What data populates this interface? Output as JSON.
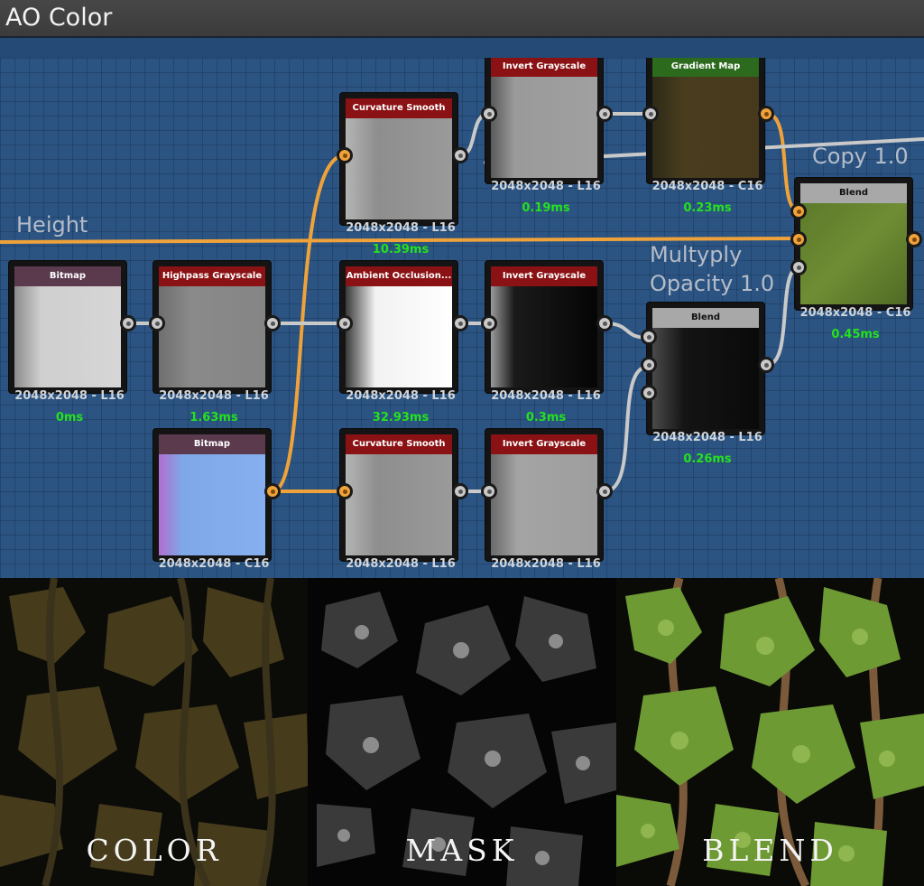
{
  "window": {
    "title": "AO Color"
  },
  "graph": {
    "labels": {
      "height": "Height",
      "copy": "Copy 1.0",
      "multiply": "Multyply",
      "opacity": "Opacity 1.0"
    },
    "nodes": [
      {
        "id": "bitmap1",
        "title": "Bitmap",
        "resolution": "2048x2048 - L16",
        "time": "0ms"
      },
      {
        "id": "highpass",
        "title": "Highpass Grayscale",
        "resolution": "2048x2048 - L16",
        "time": "1.63ms"
      },
      {
        "id": "bitmap2",
        "title": "Bitmap",
        "resolution": "2048x2048 - C16",
        "time": ""
      },
      {
        "id": "curv1",
        "title": "Curvature Smooth",
        "resolution": "2048x2048 - L16",
        "time": "10.39ms"
      },
      {
        "id": "ao",
        "title": "Ambient Occlusion...",
        "resolution": "2048x2048 - L16",
        "time": "32.93ms"
      },
      {
        "id": "curv2",
        "title": "Curvature Smooth",
        "resolution": "2048x2048 - L16",
        "time": ""
      },
      {
        "id": "inv1",
        "title": "Invert Grayscale",
        "resolution": "2048x2048 - L16",
        "time": "0.19ms"
      },
      {
        "id": "inv2",
        "title": "Invert Grayscale",
        "resolution": "2048x2048 - L16",
        "time": "0.3ms"
      },
      {
        "id": "inv3",
        "title": "Invert Grayscale",
        "resolution": "2048x2048 - L16",
        "time": ""
      },
      {
        "id": "gradient",
        "title": "Gradient Map",
        "resolution": "2048x2048 - C16",
        "time": "0.23ms"
      },
      {
        "id": "blend2",
        "title": "Blend",
        "resolution": "2048x2048 - L16",
        "time": "0.26ms"
      },
      {
        "id": "blend1",
        "title": "Blend",
        "resolution": "2048x2048 - C16",
        "time": "0.45ms"
      }
    ]
  },
  "previews": [
    {
      "id": "color",
      "label": "COLOR"
    },
    {
      "id": "mask",
      "label": "MASK"
    },
    {
      "id": "blend",
      "label": "BLEND"
    }
  ],
  "colors": {
    "graph_bg": "#2b5482",
    "wire_orange": "#f0a23a",
    "wire_gray": "#c9c9c9",
    "time_green": "#25e11e"
  }
}
